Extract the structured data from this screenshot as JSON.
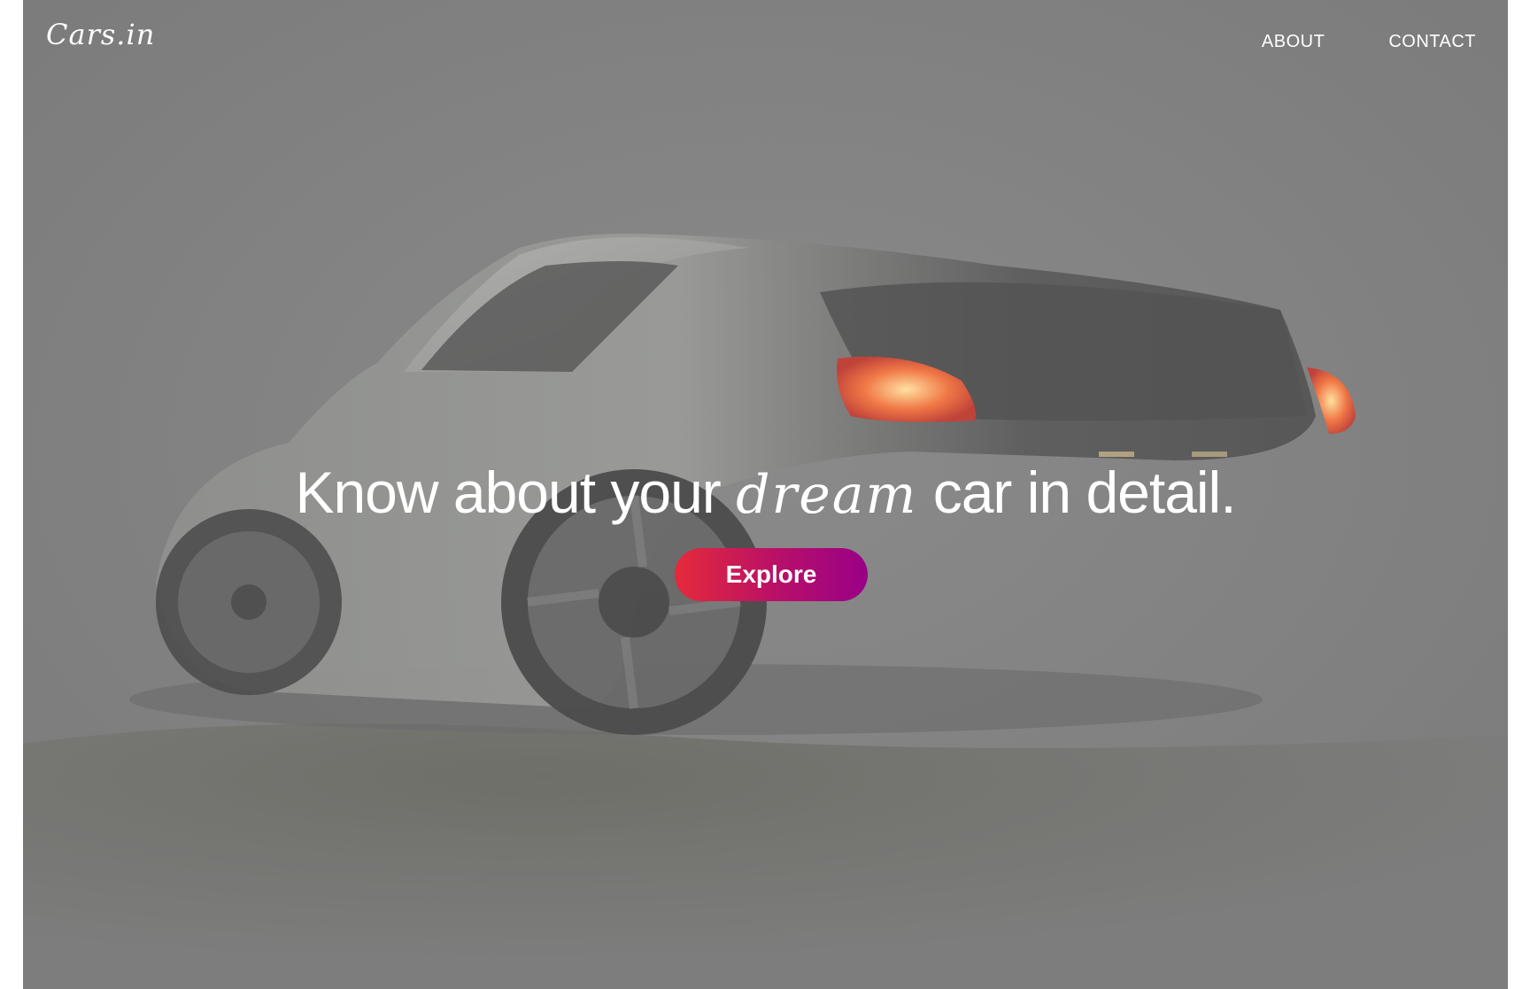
{
  "brand": {
    "logo_text": "Cars.in"
  },
  "nav": {
    "items": [
      {
        "label": "ABOUT"
      },
      {
        "label": "CONTACT"
      }
    ]
  },
  "hero": {
    "headline_before": "Know about your ",
    "headline_script": "dream",
    "headline_after": " car in detail.",
    "cta_label": "Explore",
    "image_subject": "sports-car-rear-view"
  },
  "colors": {
    "overlay": "#808080",
    "text": "#ffffff",
    "cta_gradient_start": "#e52a3a",
    "cta_gradient_end": "#990086"
  }
}
